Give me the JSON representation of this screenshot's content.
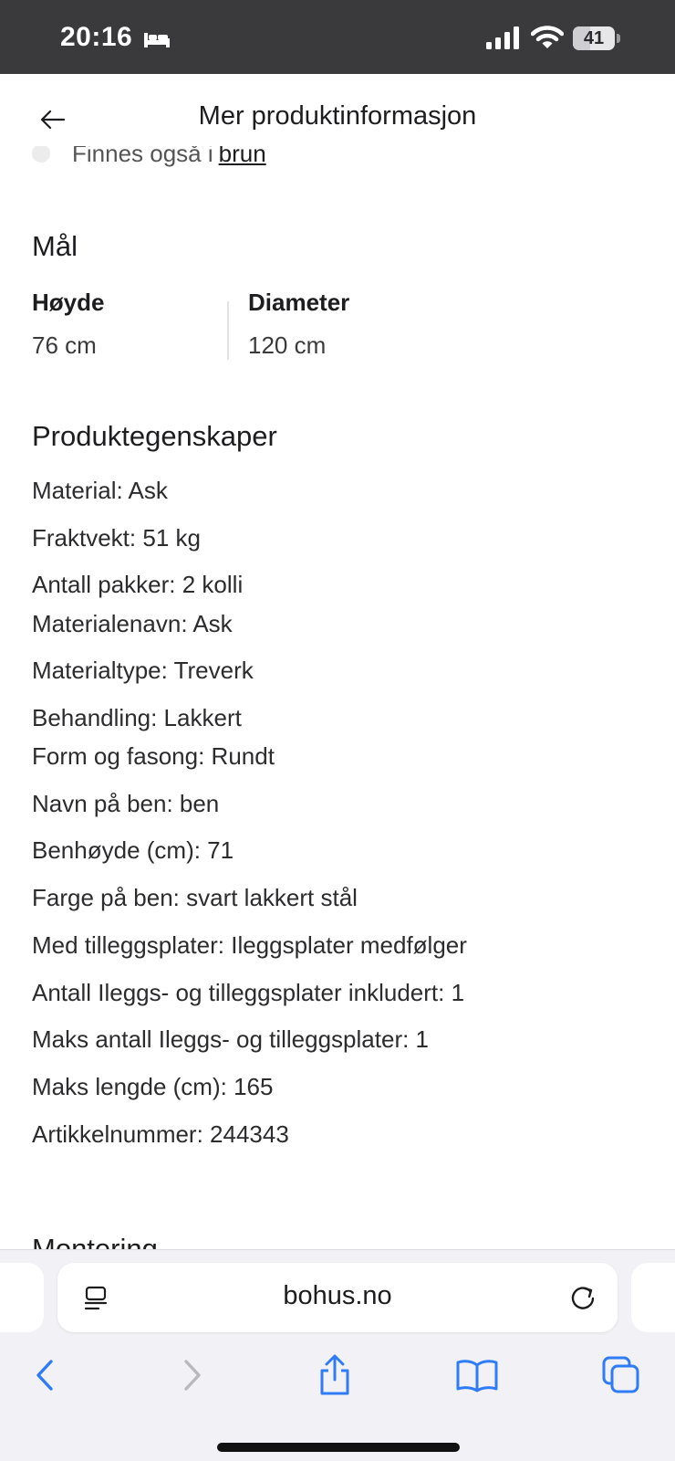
{
  "status_bar": {
    "time": "20:16",
    "battery_level": "41",
    "sleep_icon": "bed-icon",
    "signal_icon": "cellular-signal-icon",
    "wifi_icon": "wifi-icon"
  },
  "header": {
    "title": "Mer produktinformasjon",
    "back_icon": "arrow-left-icon"
  },
  "cut_row": {
    "text": "Finnes også i",
    "link": "brun"
  },
  "dimensions": {
    "title": "Mål",
    "items": [
      {
        "label": "Høyde",
        "value": "76 cm"
      },
      {
        "label": "Diameter",
        "value": "120 cm"
      }
    ]
  },
  "properties": {
    "title": "Produktegenskaper",
    "items": [
      "Material: Ask",
      "Fraktvekt: 51 kg",
      "Antall pakker: 2 kolli",
      "Materialenavn: Ask",
      "Materialtype: Treverk",
      "Behandling: Lakkert",
      "Form og fasong: Rundt",
      "Navn på ben: ben",
      "Benhøyde (cm): 71",
      "Farge på ben: svart lakkert stål",
      "Med tilleggsplater: Ileggsplater medfølger",
      "Antall Ileggs- og tilleggsplater inkludert: 1",
      "Maks antall Ileggs- og tilleggsplater: 1",
      "Maks lengde (cm): 165",
      "Artikkelnummer: 244343"
    ]
  },
  "next_section": {
    "title": "Montering"
  },
  "browser": {
    "url": "bohus.no",
    "reader_icon": "reader-mode-icon",
    "reload_icon": "reload-icon",
    "toolbar": [
      "back-icon",
      "forward-icon",
      "share-icon",
      "bookmarks-icon",
      "tabs-icon"
    ]
  },
  "colors": {
    "status_bar_bg": "#3a3a3d",
    "accent_blue": "#2f7cf6",
    "text": "#1d1d1f"
  }
}
